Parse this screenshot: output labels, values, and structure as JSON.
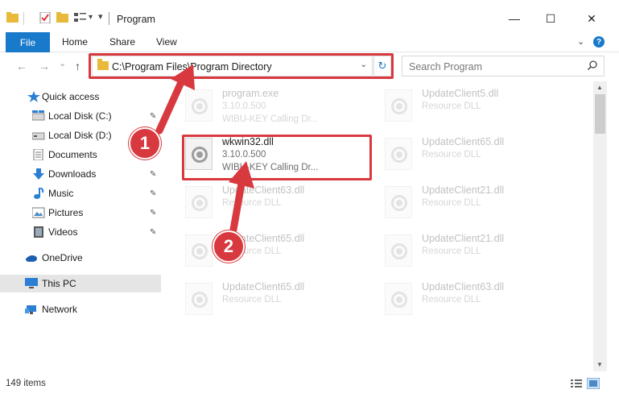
{
  "window": {
    "title": "Program",
    "minimize_glyph": "—",
    "maximize_glyph": "☐",
    "close_glyph": "✕"
  },
  "ribbon": {
    "file": "File",
    "home": "Home",
    "share": "Share",
    "view": "View",
    "expand_glyph": "⌄",
    "help_glyph": "?"
  },
  "nav": {
    "back_glyph": "←",
    "forward_glyph": "→",
    "recent_glyph": "⌄",
    "up_glyph": "↑",
    "address": "C:\\Program Files\\Program Directory",
    "address_dropdown_glyph": "⌄",
    "refresh_glyph": "↻",
    "search_placeholder": "Search Program"
  },
  "sidebar": {
    "items": [
      {
        "label": "Quick access",
        "icon": "star-icon"
      },
      {
        "label": "Local Disk (C:)",
        "icon": "drive-icon"
      },
      {
        "label": "Local Disk (D:)",
        "icon": "drive-icon"
      },
      {
        "label": "Documents",
        "icon": "documents-icon"
      },
      {
        "label": "Downloads",
        "icon": "download-icon"
      },
      {
        "label": "Music",
        "icon": "music-icon"
      },
      {
        "label": "Pictures",
        "icon": "pictures-icon"
      },
      {
        "label": "Videos",
        "icon": "videos-icon"
      },
      {
        "label": "OneDrive",
        "icon": "cloud-icon"
      },
      {
        "label": "This PC",
        "icon": "computer-icon"
      },
      {
        "label": "Network",
        "icon": "network-icon"
      }
    ],
    "pin_glyph": "📌"
  },
  "files": [
    {
      "name": "program.exe",
      "line1": "3.10.0.500",
      "line2": "WIBU-KEY Calling Dr..."
    },
    {
      "name": "UpdateClient5.dll",
      "line1": "Resource DLL",
      "line2": ""
    },
    {
      "name": "wkwin32.dll",
      "line1": "3.10.0.500",
      "line2": "WIBU-KEY Calling Dr..."
    },
    {
      "name": "UpdateClient65.dll",
      "line1": "Resource DLL",
      "line2": ""
    },
    {
      "name": "UpdateClient63.dll",
      "line1": "Resource DLL",
      "line2": ""
    },
    {
      "name": "UpdateClient21.dll",
      "line1": "Resource DLL",
      "line2": ""
    },
    {
      "name": "UpdateClient65.dll",
      "line1": "Resource DLL",
      "line2": ""
    },
    {
      "name": "UpdateClient21.dll",
      "line1": "Resource DLL",
      "line2": ""
    },
    {
      "name": "UpdateClient65.dll",
      "line1": "Resource DLL",
      "line2": ""
    },
    {
      "name": "UpdateClient63.dll",
      "line1": "Resource DLL",
      "line2": ""
    }
  ],
  "status": {
    "item_count": "149 items"
  },
  "annotations": {
    "step1": "1",
    "step2": "2",
    "highlight_color": "#d8393f"
  },
  "colors": {
    "accent": "#1979ca",
    "folder": "#e8b93a"
  }
}
